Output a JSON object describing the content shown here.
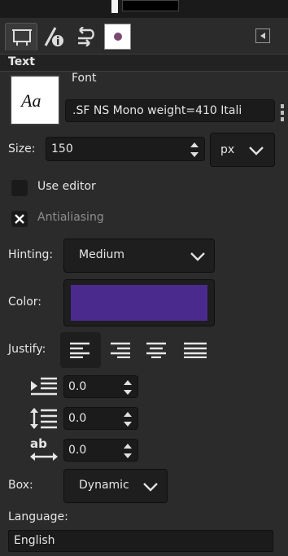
{
  "panel": {
    "section_title": "Text",
    "font": {
      "label": "Font",
      "preview": "Aa",
      "value": ".SF NS Mono weight=410 Itali"
    },
    "size": {
      "label": "Size:",
      "value": "150",
      "unit": "px"
    },
    "use_editor": {
      "label": "Use editor",
      "checked": false
    },
    "antialiasing": {
      "label": "Antialiasing",
      "checked": true
    },
    "hinting": {
      "label": "Hinting:",
      "value": "Medium"
    },
    "color": {
      "label": "Color:",
      "value": "#4b2a8e"
    },
    "justify": {
      "label": "Justify:"
    },
    "indent": {
      "value": "0.0"
    },
    "line_spacing": {
      "value": "0.0"
    },
    "letter_spacing": {
      "value": "0.0"
    },
    "box": {
      "label": "Box:",
      "value": "Dynamic"
    },
    "language": {
      "label": "Language:",
      "value": "English"
    }
  },
  "icons": {
    "tab_tool_options": "text-tool-icon",
    "tab_device_status": "device-status-icon",
    "tab_undo_history": "undo-history-icon",
    "tab_images": "image-thumbnail-icon",
    "configure": "panel-menu-icon"
  }
}
